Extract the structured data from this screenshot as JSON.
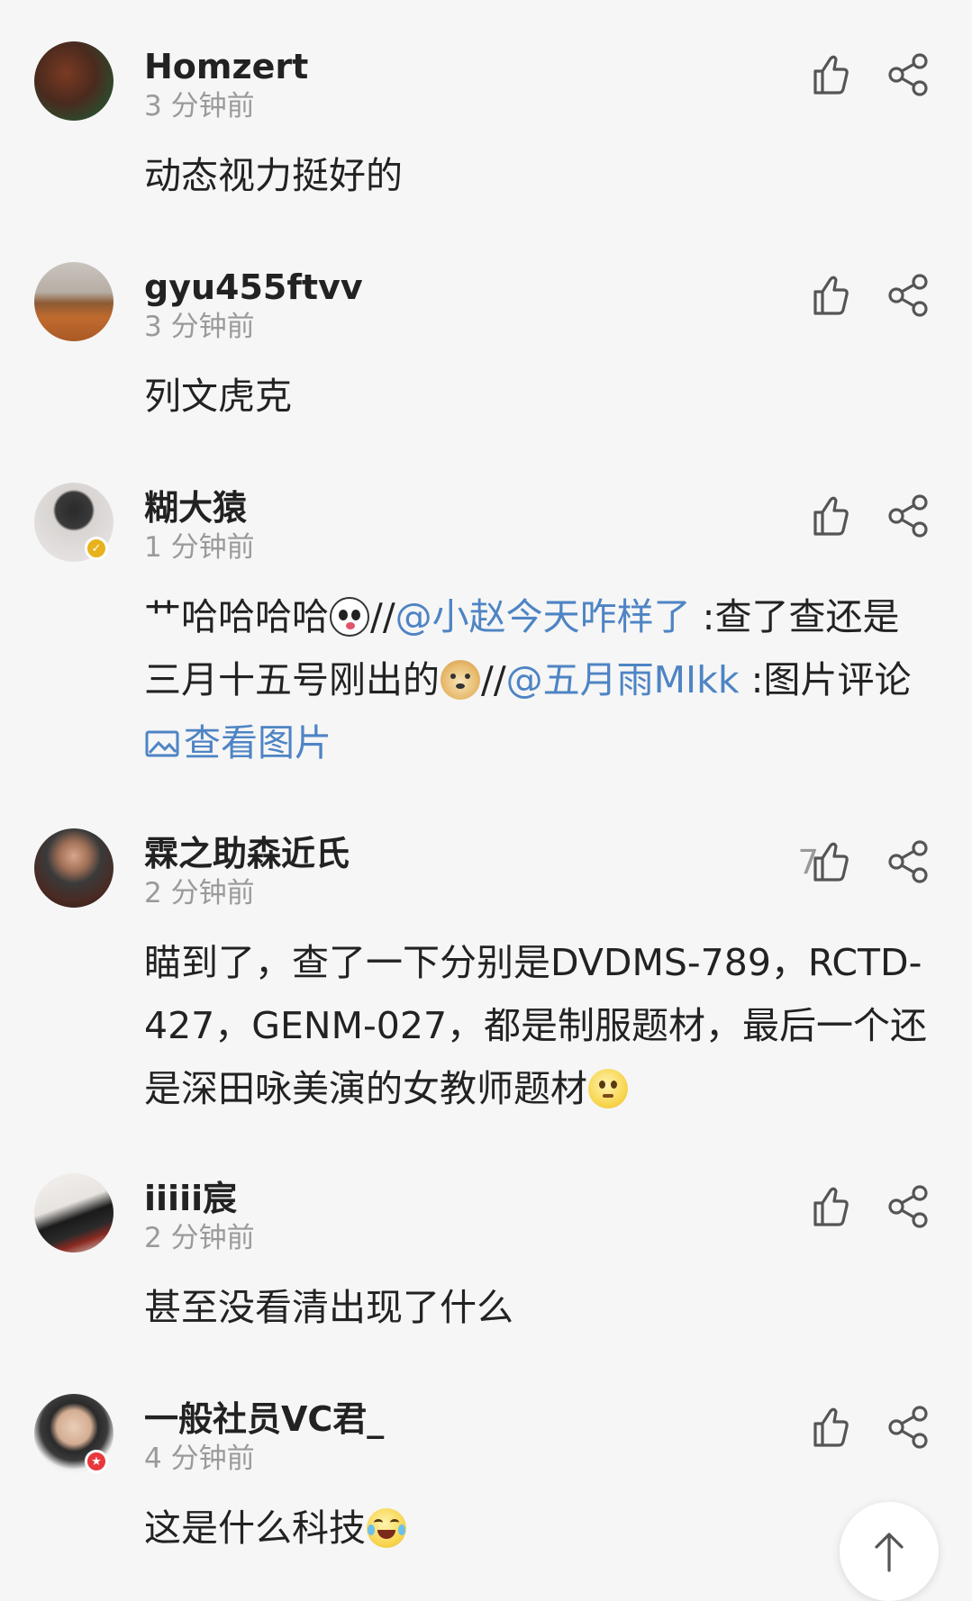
{
  "comments": [
    {
      "username": "Homzert",
      "time": "3 分钟前",
      "text": "动态视力挺好的"
    },
    {
      "username": "gyu455ftvv",
      "time": "3 分钟前",
      "text": "列文虎克"
    },
    {
      "username": "糊大猿",
      "time": "1 分钟前",
      "text_parts": {
        "p1": "艹哈哈哈哈",
        "p2": "//",
        "mention1": "@小赵今天咋样了",
        "p3": " :查了查还是三月十五号刚出的",
        "p4": "//",
        "mention2": "@五月雨MIkk",
        "p5": " :图片评论 ",
        "view_image": "查看图片"
      }
    },
    {
      "username": "霖之助森近氏",
      "time": "2 分钟前",
      "likes": "7",
      "text": "瞄到了，查了一下分别是DVDMS-789，RCTD-427，GENM-027，都是制服题材，最后一个还是深田咏美演的女教师题材"
    },
    {
      "username": "iiiii宸",
      "time": "2 分钟前",
      "text": "甚至没看清出现了什么"
    },
    {
      "username": "一般社员VC君_",
      "time": "4 分钟前",
      "text": "这是什么科技"
    }
  ],
  "icons": {
    "like": "thumbs-up-icon",
    "share": "share-icon",
    "view_image": "image-icon",
    "scroll_top": "arrow-up-icon",
    "emoji_1": "panda-emoji",
    "emoji_2": "doge-emoji",
    "emoji_3": "thinking-emoji",
    "emoji_4": "laugh-cry-emoji"
  },
  "colors": {
    "link": "#4e84c4",
    "time": "#9a9a9a",
    "background": "#f6f6f6"
  }
}
